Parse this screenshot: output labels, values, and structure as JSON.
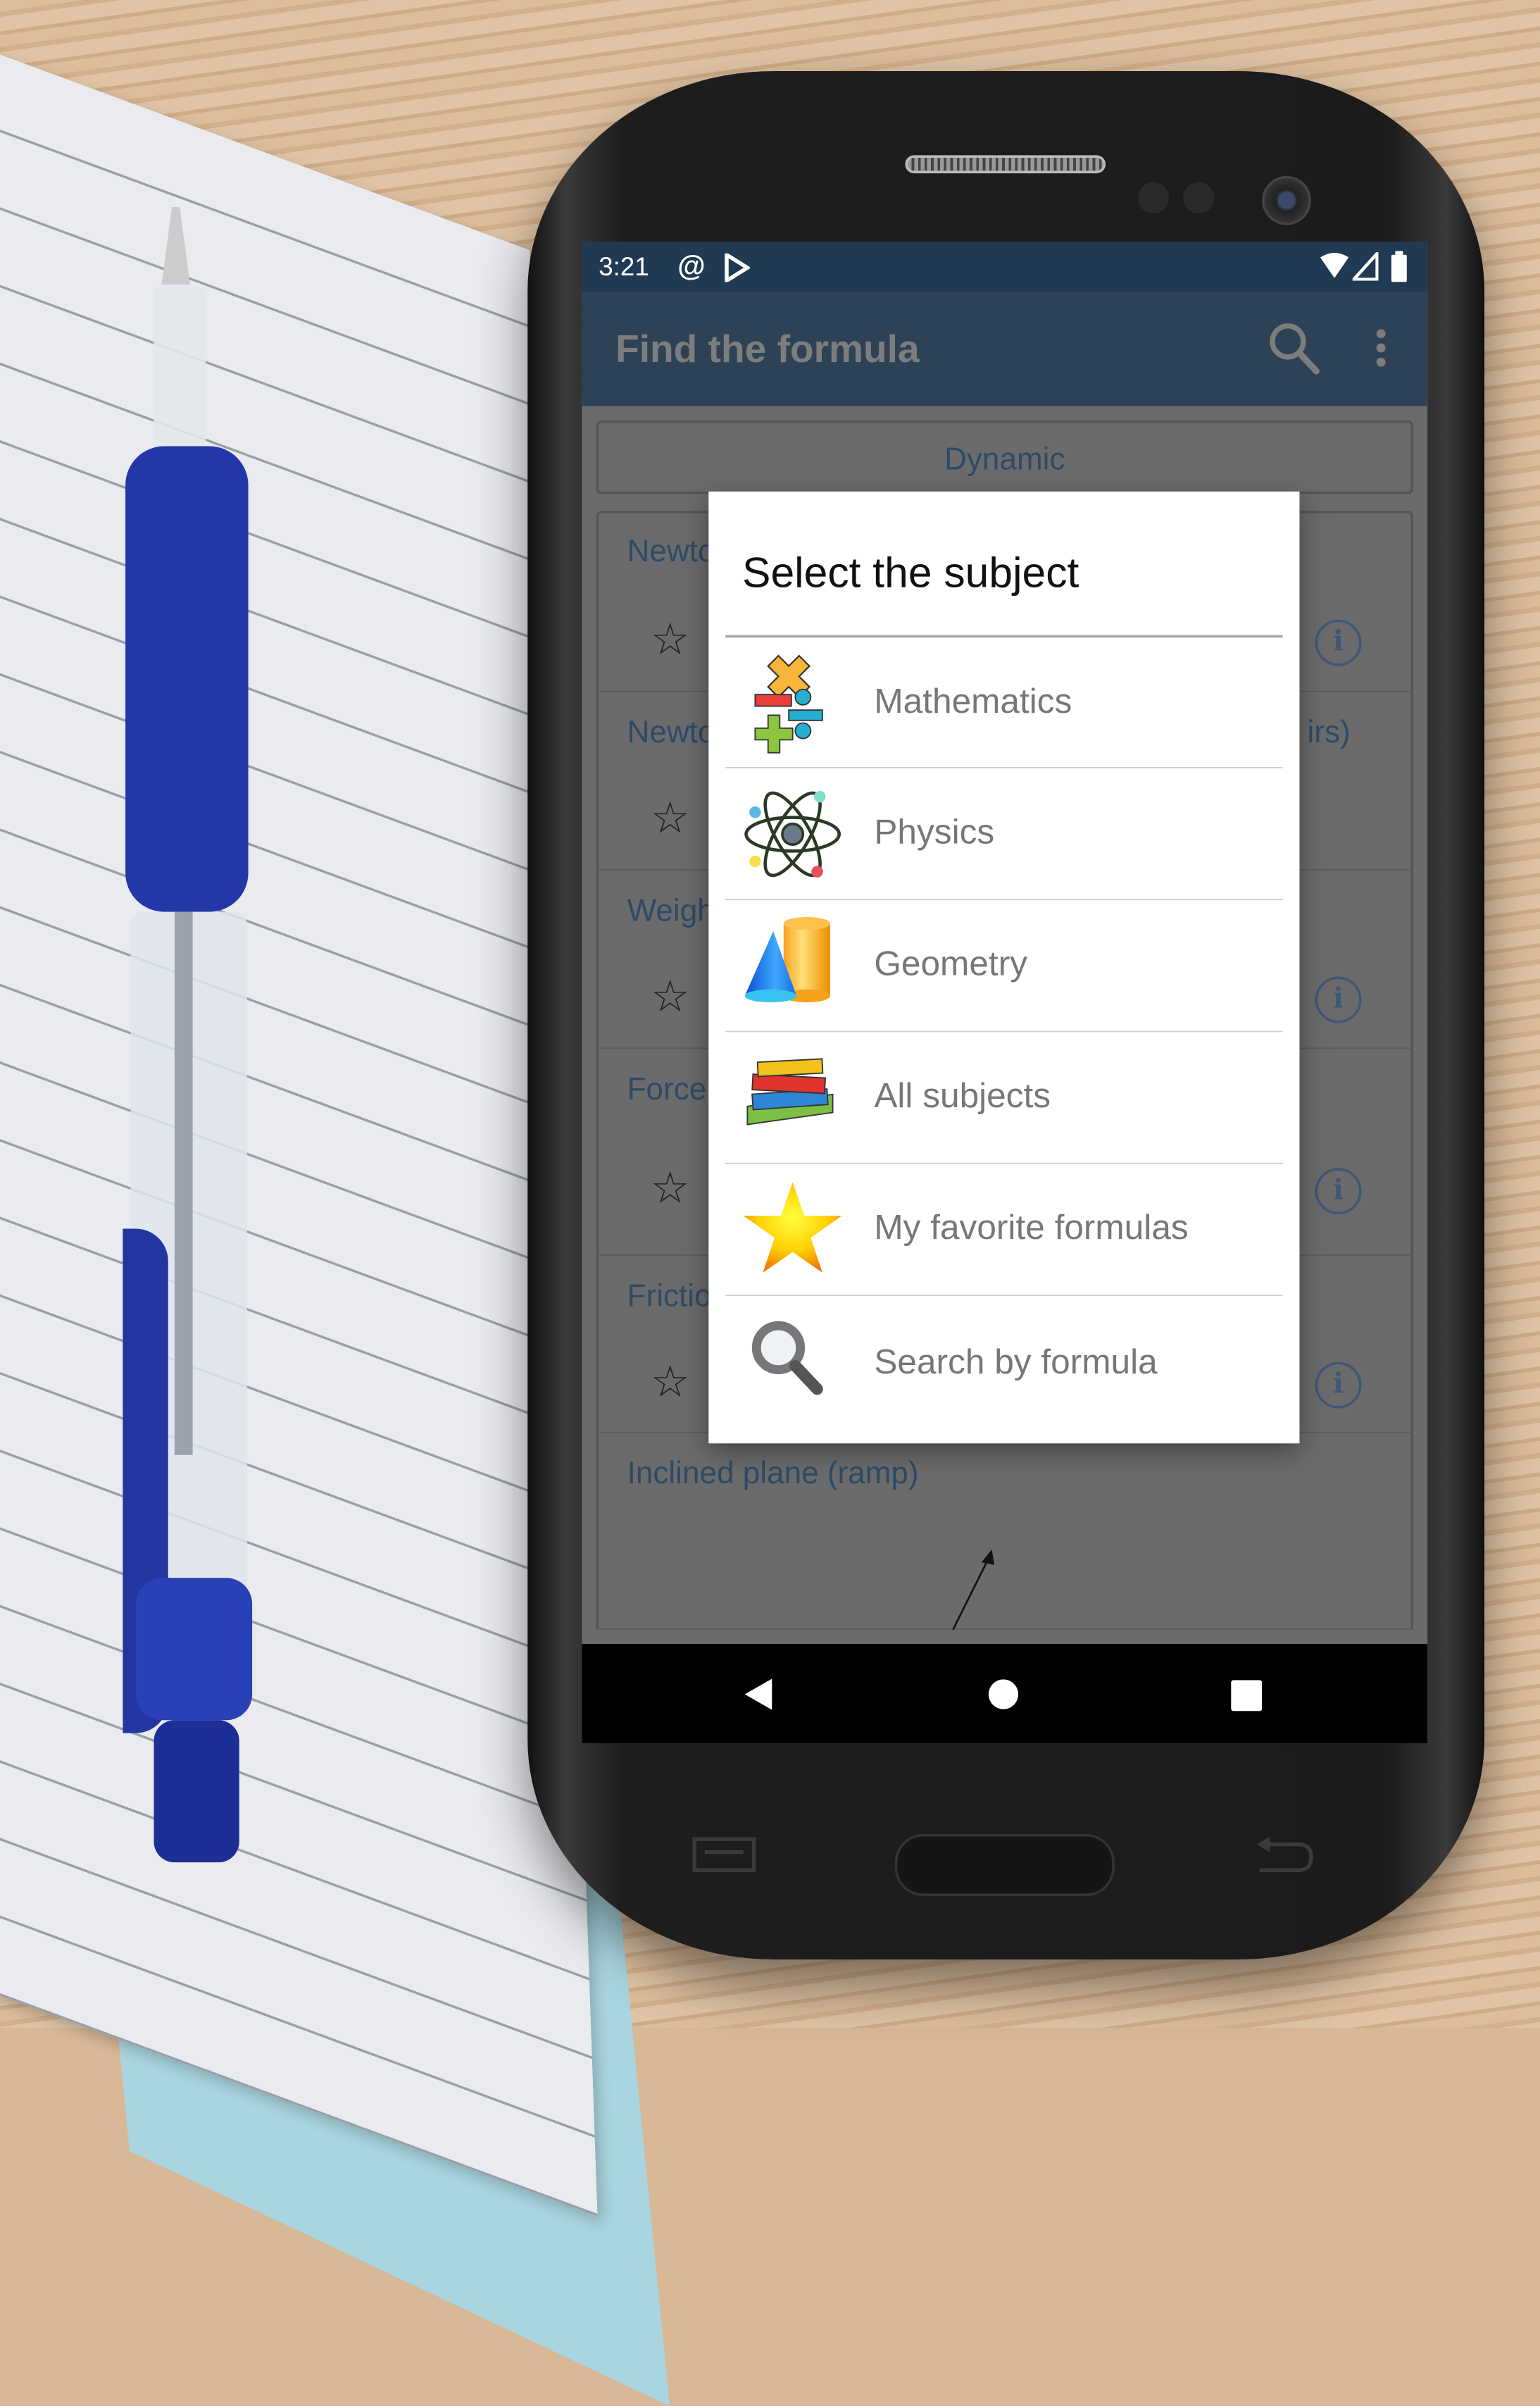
{
  "status_bar": {
    "time": "3:21",
    "icons": [
      "at-sign-icon",
      "play-store-icon",
      "wifi-icon",
      "signal-icon",
      "battery-icon"
    ]
  },
  "app_bar": {
    "title": "Find the formula",
    "icons": [
      "search-icon",
      "more-vert-icon"
    ]
  },
  "background_list": {
    "category_button": "Dynamic",
    "cards": [
      {
        "title_left": "Newto",
        "title_right": ""
      },
      {
        "title_left": "Newto",
        "title_right": "irs)"
      },
      {
        "title_left": "Weight",
        "title_right": ""
      },
      {
        "title_left": "Force c",
        "title_right": ""
      },
      {
        "title_left": "Friction",
        "title_right": ""
      },
      {
        "title_left": "Inclined plane (ramp)",
        "title_right": ""
      }
    ]
  },
  "dialog": {
    "title": "Select the subject",
    "options": [
      {
        "label": "Mathematics",
        "icon": "math-operators-icon"
      },
      {
        "label": "Physics",
        "icon": "atom-icon"
      },
      {
        "label": "Geometry",
        "icon": "geometry-shapes-icon"
      },
      {
        "label": "All subjects",
        "icon": "books-icon"
      },
      {
        "label": "My favorite formulas",
        "icon": "star-icon"
      },
      {
        "label": "Search by formula",
        "icon": "magnifier-icon"
      }
    ]
  },
  "nav_bar": {
    "icons": [
      "back-icon",
      "home-icon",
      "recents-icon"
    ]
  },
  "colors": {
    "status_bar": "#1f3a52",
    "app_bar": "#2e4257",
    "card_text": "#2d4a66",
    "dialog_bg": "#ffffff",
    "scrim": "#6b6b6b"
  }
}
